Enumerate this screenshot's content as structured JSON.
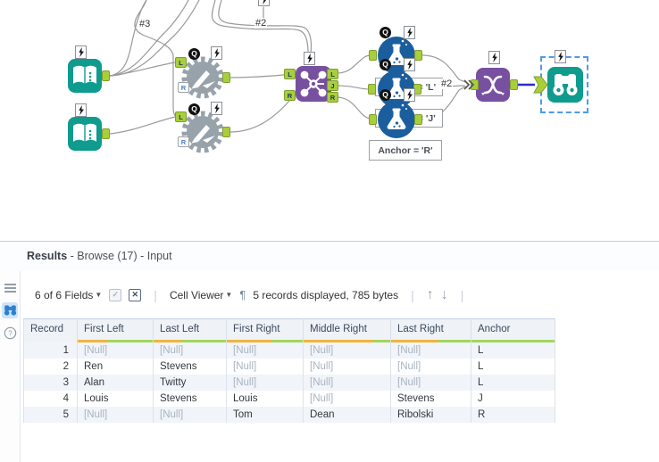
{
  "canvas": {
    "labels": {
      "n3": "#3",
      "n2_top": "#2",
      "n2_mid": "#2"
    },
    "annotations": {
      "l": "Anchor = 'L'",
      "j": "Anchor = 'J'",
      "r": "Anchor = 'R'"
    },
    "letters": {
      "q": "Q",
      "l": "L",
      "r": "R",
      "j": "J"
    },
    "icons": [
      "book-icon",
      "gear-macro-icon",
      "join-icon",
      "flask-macro-icon",
      "union-icon",
      "binoculars-icon",
      "lightning-icon",
      "question-anchor-icon"
    ],
    "colors": {
      "teal": "#0F9B8E",
      "purple": "#7850A0",
      "flask_blue": "#1B5E9E",
      "anchor_green": "#A9CE3B",
      "wire_gray": "#9A9A9A",
      "selected_wire": "#2B2BD0",
      "selection_dash": "#4D9BE9"
    }
  },
  "results": {
    "title_bold": "Results",
    "title_rest": " - Browse (17) - Input",
    "toolbar": {
      "fields": "6 of 6 Fields",
      "cell_viewer": "Cell Viewer",
      "records": "5 records displayed, 785 bytes",
      "check_icon": "✓",
      "x_icon": "✕",
      "pilcrow": "¶",
      "up_arrow": "↑",
      "down_arrow": "↓"
    },
    "sidebar_icons": [
      "list-icon",
      "binoculars-icon",
      "help-icon"
    ],
    "table": {
      "columns": [
        {
          "label": "Record",
          "null_fraction": null
        },
        {
          "label": "First Left",
          "null_fraction": 0.4
        },
        {
          "label": "Last Left",
          "null_fraction": 0.4
        },
        {
          "label": "First Right",
          "null_fraction": 0.6
        },
        {
          "label": "Middle Right",
          "null_fraction": 0.8
        },
        {
          "label": "Last Right",
          "null_fraction": 0.6
        },
        {
          "label": "Anchor",
          "null_fraction": 0.0
        }
      ],
      "null_token": "[Null]",
      "rows": [
        [
          "1",
          "[Null]",
          "[Null]",
          "[Null]",
          "[Null]",
          "[Null]",
          "L"
        ],
        [
          "2",
          "Ren",
          "Stevens",
          "[Null]",
          "[Null]",
          "[Null]",
          "L"
        ],
        [
          "3",
          "Alan",
          "Twitty",
          "[Null]",
          "[Null]",
          "[Null]",
          "L"
        ],
        [
          "4",
          "Louis",
          "Stevens",
          "Louis",
          "[Null]",
          "Stevens",
          "J"
        ],
        [
          "5",
          "[Null]",
          "[Null]",
          "Tom",
          "Dean",
          "Ribolski",
          "R"
        ]
      ]
    }
  }
}
